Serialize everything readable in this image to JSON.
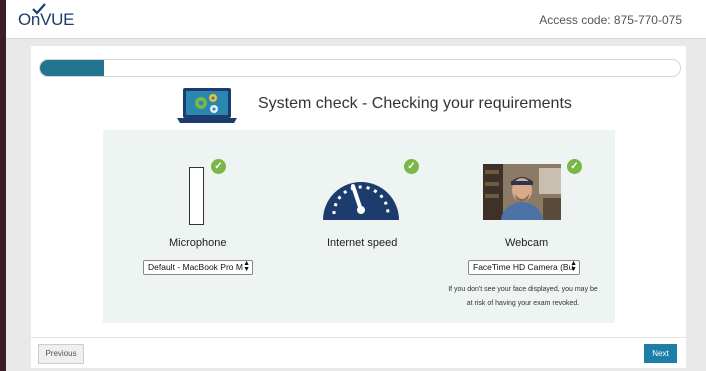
{
  "header": {
    "logo_text": "OnVUE",
    "access_code": "Access code: 875-770-075"
  },
  "progress": {
    "fraction": 0.1
  },
  "main": {
    "title": "System check - Checking your requirements"
  },
  "checks": {
    "microphone": {
      "label": "Microphone",
      "selected": "Default - MacBook Pro M",
      "status": "ok"
    },
    "internet": {
      "label": "Internet speed",
      "status": "ok"
    },
    "webcam": {
      "label": "Webcam",
      "selected": "FaceTime HD Camera (Bu",
      "status": "ok",
      "warning_line1": "If you don't see your face displayed, you may be",
      "warning_line2": "at risk of having your exam revoked."
    }
  },
  "footer": {
    "previous_label": "Previous",
    "next_label": "Next"
  },
  "colors": {
    "brand_navy": "#1d3c6e",
    "progress_teal": "#23748f",
    "ok_green": "#7ab648",
    "next_blue": "#1e7fa6",
    "panel_bg": "#eef4f1"
  },
  "icons": [
    "onvue-logo",
    "laptop-gears-icon",
    "check-icon",
    "speedometer-icon",
    "select-arrows-icon"
  ]
}
